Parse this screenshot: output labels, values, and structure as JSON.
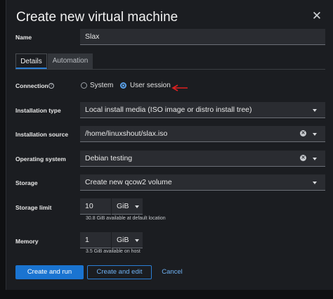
{
  "dialog": {
    "title": "Create new virtual machine",
    "close_icon": "close-icon"
  },
  "name": {
    "label": "Name",
    "value": "Slax"
  },
  "tabs": [
    {
      "label": "Details",
      "active": true
    },
    {
      "label": "Automation",
      "active": false
    }
  ],
  "connection": {
    "label": "Connection",
    "help_icon": "help-icon",
    "options": [
      {
        "label": "System",
        "selected": false
      },
      {
        "label": "User session",
        "selected": true
      }
    ],
    "annotation_color": "#e02020"
  },
  "installation_type": {
    "label": "Installation type",
    "value": "Local install media (ISO image or distro install tree)"
  },
  "installation_source": {
    "label": "Installation source",
    "value": "/home/linuxshout/slax.iso"
  },
  "operating_system": {
    "label": "Operating system",
    "value": "Debian testing"
  },
  "storage": {
    "label": "Storage",
    "value": "Create new qcow2 volume"
  },
  "storage_limit": {
    "label": "Storage limit",
    "value": "10",
    "unit": "GiB",
    "helper": "30.8 GiB available at default location"
  },
  "memory": {
    "label": "Memory",
    "value": "1",
    "unit": "GiB",
    "helper": "3.5 GiB available on host"
  },
  "actions": {
    "create_and_run": "Create and run",
    "create_and_edit": "Create and edit",
    "cancel": "Cancel"
  },
  "colors": {
    "primary": "#1a74d1",
    "link": "#6fb1f2",
    "background": "#1b1d21"
  }
}
